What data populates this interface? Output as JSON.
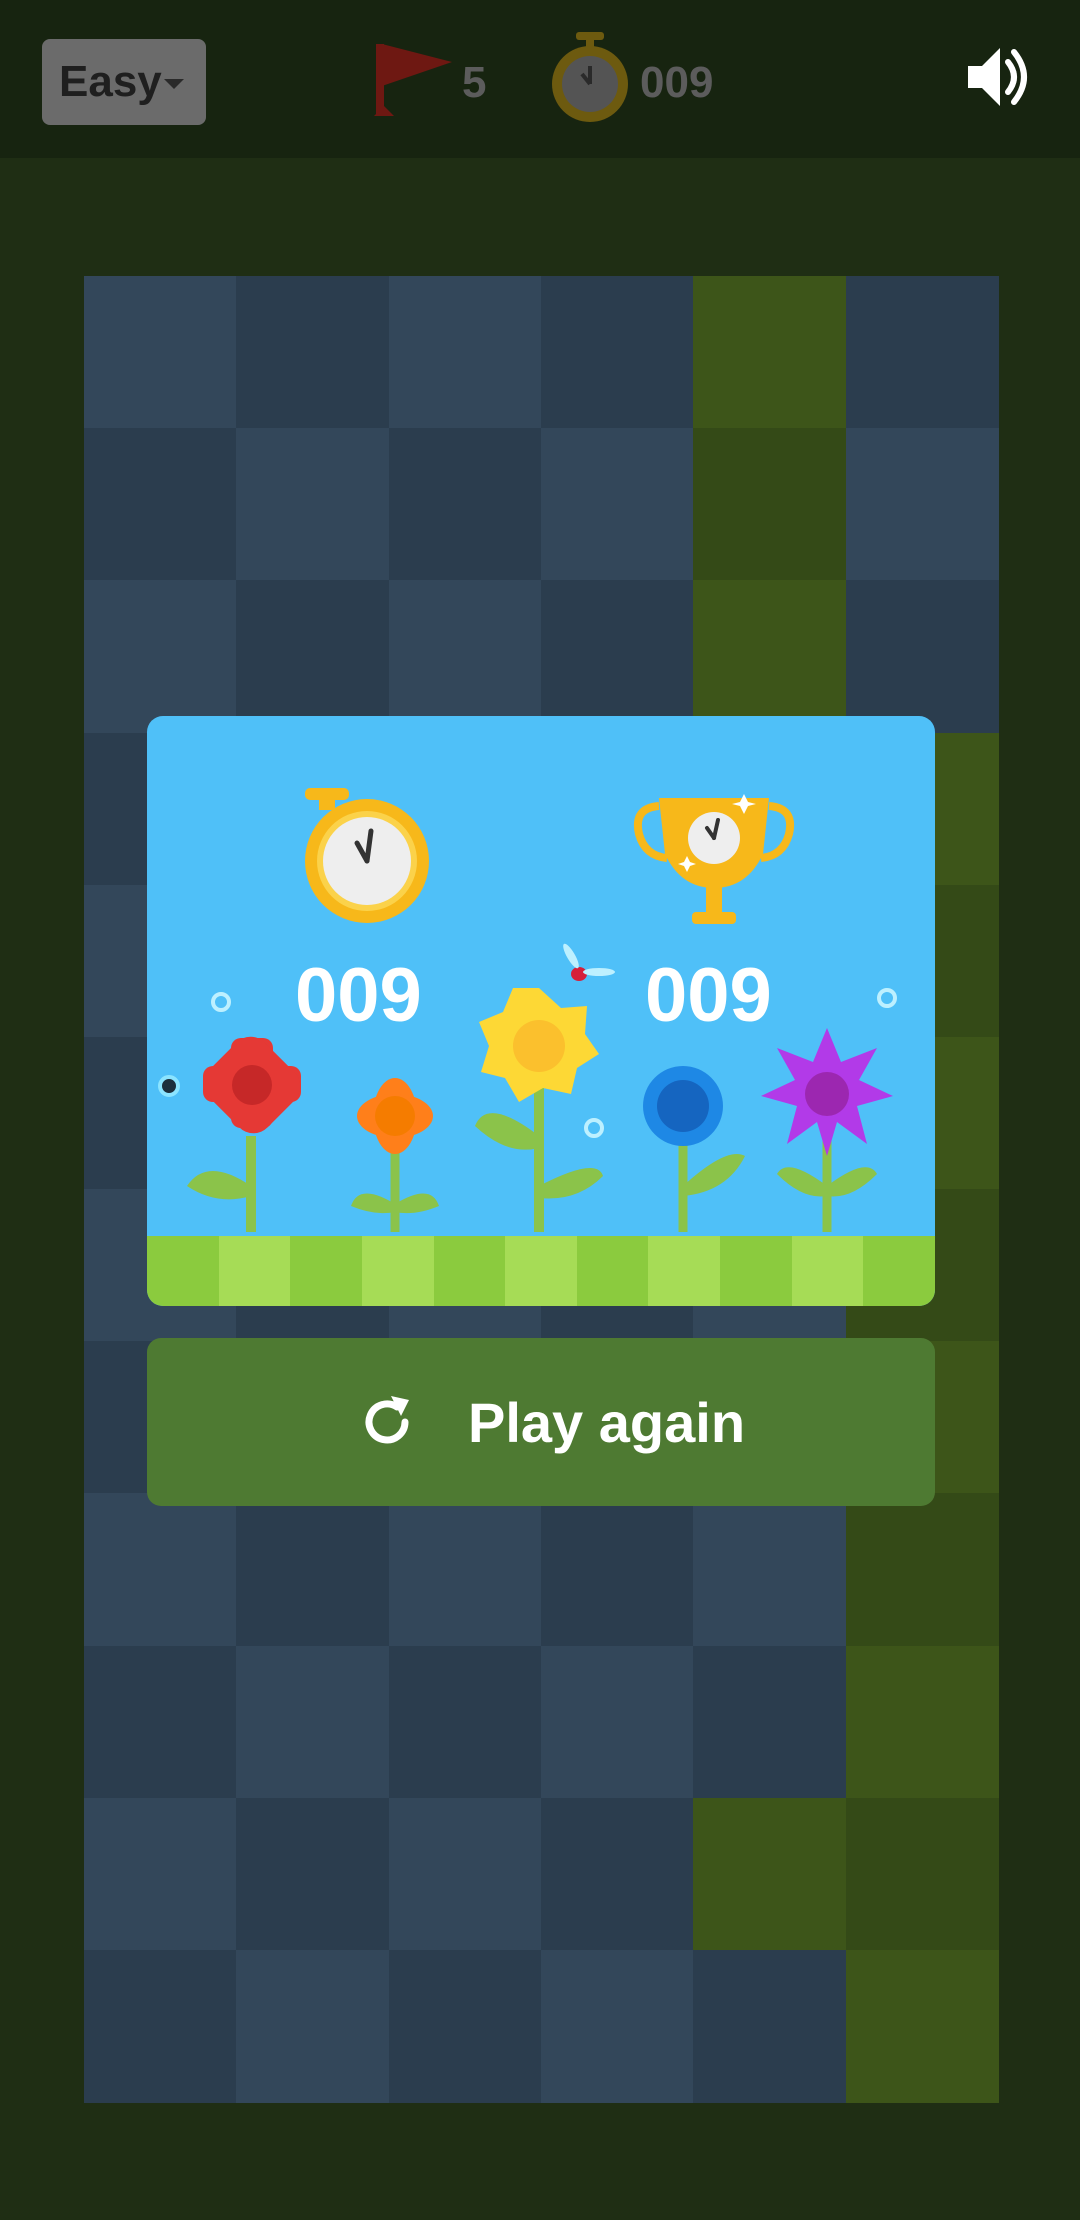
{
  "header": {
    "difficulty": "Easy",
    "flags_left": "5",
    "timer": "009"
  },
  "result": {
    "current_time": "009",
    "best_time": "009"
  },
  "actions": {
    "play_again_label": "Play again"
  },
  "colors": {
    "board_dark": "#2b3d4e",
    "board_light": "#33475a",
    "revealed_dark": "#344a17",
    "revealed_light": "#3d5519",
    "dialog_bg": "#4fc0f8",
    "play_again_bg": "#4e7a32"
  }
}
